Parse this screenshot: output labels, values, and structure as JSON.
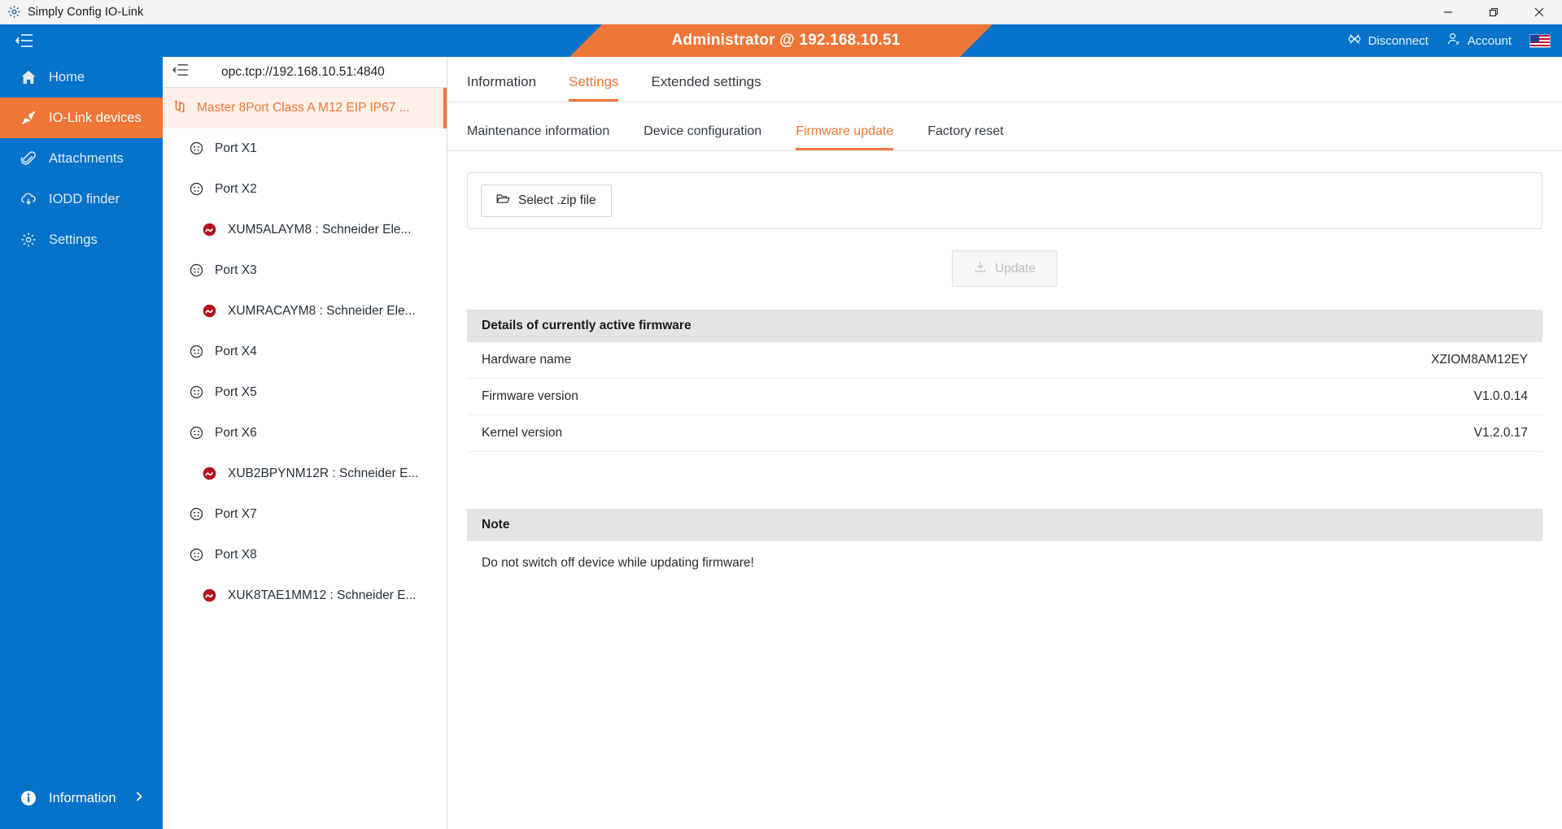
{
  "window": {
    "title": "Simply Config IO-Link",
    "app_icon": "gear-logo-icon",
    "minimize": "minimize-icon",
    "maximize": "restore-icon",
    "close": "close-icon"
  },
  "header": {
    "menu_toggle_icon": "collapse-menu-icon",
    "banner_text": "Administrator @ 192.168.10.51",
    "banner_color": "#f07637",
    "bar_color": "#0572ca",
    "disconnect_label": "Disconnect",
    "disconnect_icon": "disconnect-icon",
    "account_label": "Account",
    "account_icon": "account-icon",
    "language_flag": "us-flag-icon"
  },
  "sidebar": {
    "items": [
      {
        "label": "Home",
        "icon": "home-icon",
        "active": false
      },
      {
        "label": "IO-Link devices",
        "icon": "iolink-plug-icon",
        "active": true
      },
      {
        "label": "Attachments",
        "icon": "paperclip-icon",
        "active": false
      },
      {
        "label": "IODD finder",
        "icon": "cloud-download-icon",
        "active": false
      },
      {
        "label": "Settings",
        "icon": "gear-icon",
        "active": false
      }
    ],
    "bottom": {
      "label": "Information",
      "icon": "info-icon",
      "chevron": "chevron-right-icon"
    }
  },
  "tree": {
    "toggle_icon": "collapse-tree-icon",
    "endpoint": "opc.tcp://192.168.10.51:4840",
    "rows": [
      {
        "label": "Master 8Port Class A M12 EIP IP67 ...",
        "type": "master",
        "icon": "master-icon",
        "selected": true
      },
      {
        "label": "Port X1",
        "type": "port",
        "icon": "m12-port-icon",
        "selected": false
      },
      {
        "label": "Port X2",
        "type": "port",
        "icon": "m12-port-icon",
        "selected": false
      },
      {
        "label": "XUM5ALAYM8 : Schneider Ele...",
        "type": "device",
        "icon": "sensor-icon",
        "selected": false
      },
      {
        "label": "Port X3",
        "type": "port",
        "icon": "m12-port-icon",
        "selected": false
      },
      {
        "label": "XUMRACAYM8 : Schneider Ele...",
        "type": "device",
        "icon": "sensor-icon",
        "selected": false
      },
      {
        "label": "Port X4",
        "type": "port",
        "icon": "m12-port-icon",
        "selected": false
      },
      {
        "label": "Port X5",
        "type": "port",
        "icon": "m12-port-icon",
        "selected": false
      },
      {
        "label": "Port X6",
        "type": "port",
        "icon": "m12-port-icon",
        "selected": false
      },
      {
        "label": "XUB2BPYNM12R : Schneider E...",
        "type": "device",
        "icon": "sensor-icon",
        "selected": false
      },
      {
        "label": "Port X7",
        "type": "port",
        "icon": "m12-port-icon",
        "selected": false
      },
      {
        "label": "Port X8",
        "type": "port",
        "icon": "m12-port-icon",
        "selected": false
      },
      {
        "label": "XUK8TAE1MM12 : Schneider E...",
        "type": "device",
        "icon": "sensor-icon",
        "selected": false
      }
    ]
  },
  "main": {
    "tabs": [
      {
        "label": "Information",
        "active": false
      },
      {
        "label": "Settings",
        "active": true
      },
      {
        "label": "Extended settings",
        "active": false
      }
    ],
    "subtabs": [
      {
        "label": "Maintenance information",
        "active": false
      },
      {
        "label": "Device configuration",
        "active": false
      },
      {
        "label": "Firmware update",
        "active": true
      },
      {
        "label": "Factory reset",
        "active": false
      }
    ],
    "select_file_label": "Select .zip file",
    "select_file_icon": "folder-open-icon",
    "update_label": "Update",
    "update_icon": "download-icon",
    "update_disabled": true,
    "firmware_section_title": "Details of currently active firmware",
    "firmware_details": [
      {
        "key": "Hardware name",
        "value": "XZIOM8AM12EY"
      },
      {
        "key": "Firmware version",
        "value": "V1.0.0.14"
      },
      {
        "key": "Kernel version",
        "value": "V1.2.0.17"
      }
    ],
    "note_title": "Note",
    "note_text": "Do not switch off device while updating firmware!"
  },
  "colors": {
    "accent_orange": "#f07637",
    "brand_blue": "#0572ca",
    "device_red": "#b3121d"
  }
}
